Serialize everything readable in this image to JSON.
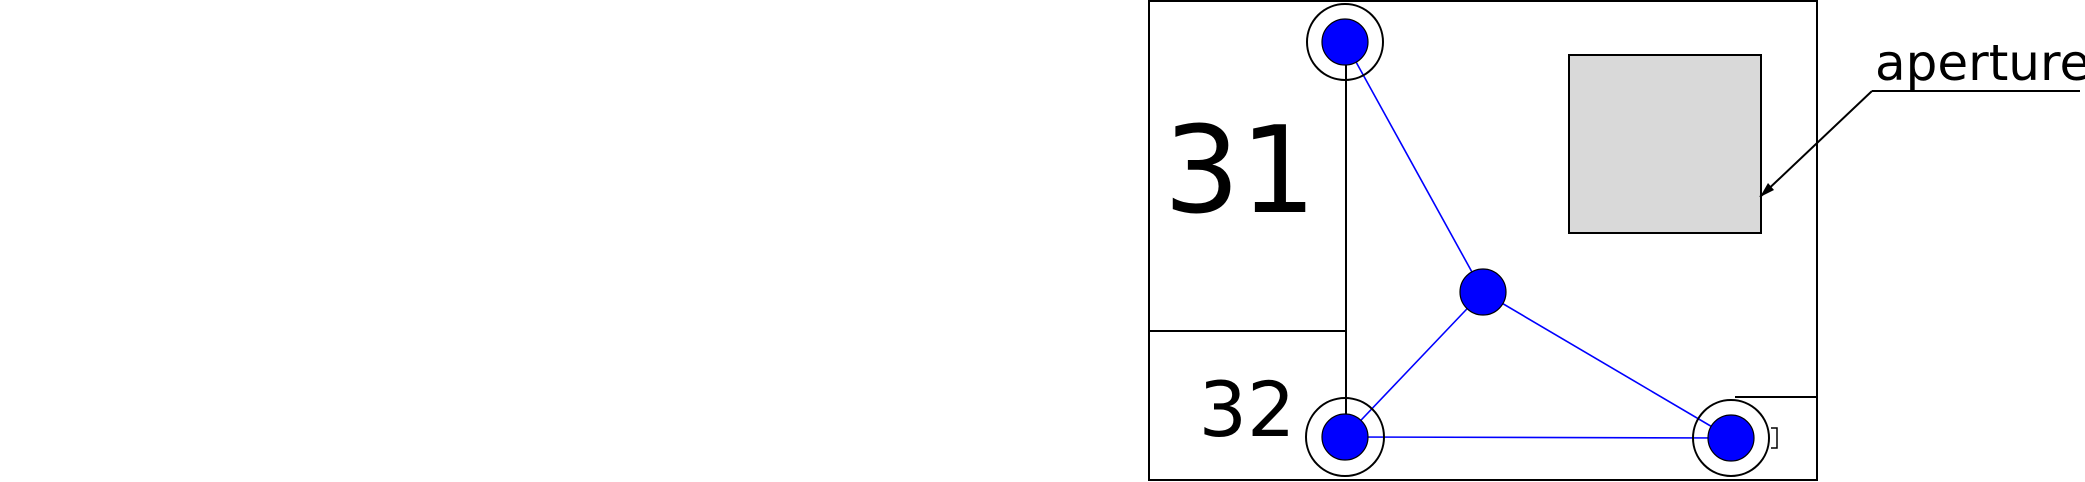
{
  "labels": {
    "region_31": "31",
    "region_32": "32",
    "aperture": "aperture"
  },
  "colors": {
    "node_fill": "#0000ff",
    "link_stroke": "#0000ff",
    "outline": "#000000",
    "aperture_fill": "#d9d9d9",
    "background": "#ffffff"
  }
}
